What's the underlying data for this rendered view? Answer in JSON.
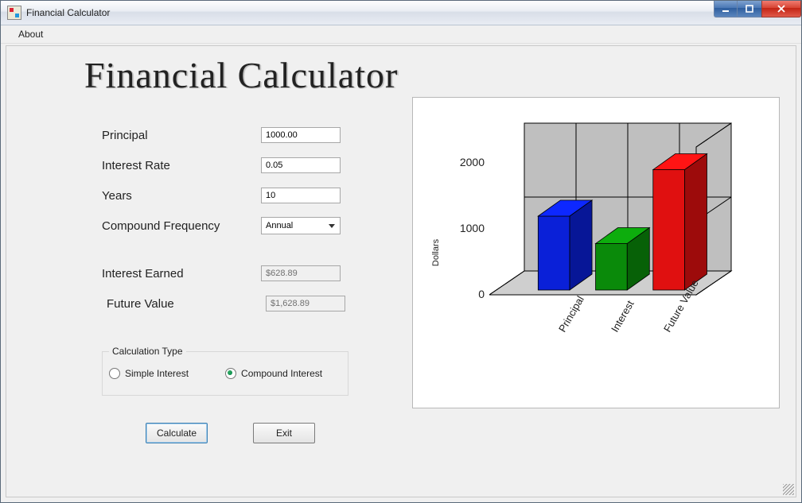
{
  "window": {
    "title": "Financial Calculator"
  },
  "menu": {
    "about": "About"
  },
  "heading": "Financial Calculator",
  "labels": {
    "principal": "Principal",
    "rate": "Interest Rate",
    "years": "Years",
    "freq": "Compound Frequency",
    "interest_earned": "Interest Earned",
    "future_value": "Future Value"
  },
  "inputs": {
    "principal": "1000.00",
    "rate": "0.05",
    "years": "10",
    "freq": "Annual",
    "interest_earned": "$628.89",
    "future_value": "$1,628.89"
  },
  "group": {
    "title": "Calculation Type",
    "simple": "Simple Interest",
    "compound": "Compound Interest",
    "selected": "compound"
  },
  "buttons": {
    "calculate": "Calculate",
    "exit": "Exit"
  },
  "chart": {
    "ylabel": "Dollars",
    "ticks": [
      "0",
      "1000",
      "2000"
    ],
    "categories": [
      "Principal",
      "Interest",
      "Future Value"
    ]
  },
  "chart_data": {
    "type": "bar",
    "categories": [
      "Principal",
      "Interest",
      "Future Value"
    ],
    "values": [
      1000.0,
      628.89,
      1628.89
    ],
    "colors": [
      "#0a20d8",
      "#0a8a0a",
      "#e01010"
    ],
    "ylabel": "Dollars",
    "ylim": [
      0,
      2000
    ],
    "yticks": [
      0,
      1000,
      2000
    ]
  }
}
